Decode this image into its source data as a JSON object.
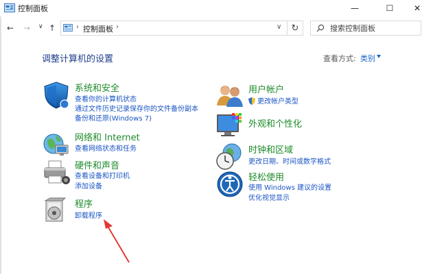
{
  "window": {
    "title": "控制面板",
    "controls": {
      "minimize": "—",
      "maximize": "☐",
      "close": "✕"
    }
  },
  "nav": {
    "back": "←",
    "forward": "→",
    "recent": "∨",
    "up": "↑",
    "breadcrumb_sep": "›",
    "address": "控制面板",
    "dropdown": "∨",
    "refresh": "↻"
  },
  "search": {
    "placeholder": "搜索控制面板"
  },
  "main": {
    "headline": "调整计算机的设置",
    "view_by_label": "查看方式:",
    "view_by_value": "类别"
  },
  "categories": {
    "system": {
      "title": "系统和安全",
      "links": [
        "查看你的计算机状态",
        "通过文件历史记录保存你的文件备份副本",
        "备份和还原(Windows 7)"
      ],
      "icon": "shield-icon"
    },
    "network": {
      "title": "网络和 Internet",
      "links": [
        "查看网络状态和任务"
      ],
      "icon": "network-globe-icon"
    },
    "hardware": {
      "title": "硬件和声音",
      "links": [
        "查看设备和打印机",
        "添加设备"
      ],
      "icon": "printer-icon"
    },
    "programs": {
      "title": "程序",
      "links": [
        "卸载程序"
      ],
      "icon": "programs-disc-icon"
    },
    "user": {
      "title": "用户帐户",
      "links": [
        "更改帐户类型"
      ],
      "icon": "users-icon"
    },
    "appearance": {
      "title": "外观和个性化",
      "links": [],
      "icon": "monitor-palette-icon"
    },
    "clock": {
      "title": "时钟和区域",
      "links": [
        "更改日期、时间或数字格式"
      ],
      "icon": "clock-globe-icon"
    },
    "ease": {
      "title": "轻松使用",
      "links": [
        "使用 Windows 建议的设置",
        "优化视觉显示"
      ],
      "icon": "accessibility-icon"
    }
  },
  "colors": {
    "category_title": "#1d8a2a",
    "link": "#1a55c4",
    "headline": "#1e3f8a",
    "annotation_arrow": "#e53935"
  }
}
